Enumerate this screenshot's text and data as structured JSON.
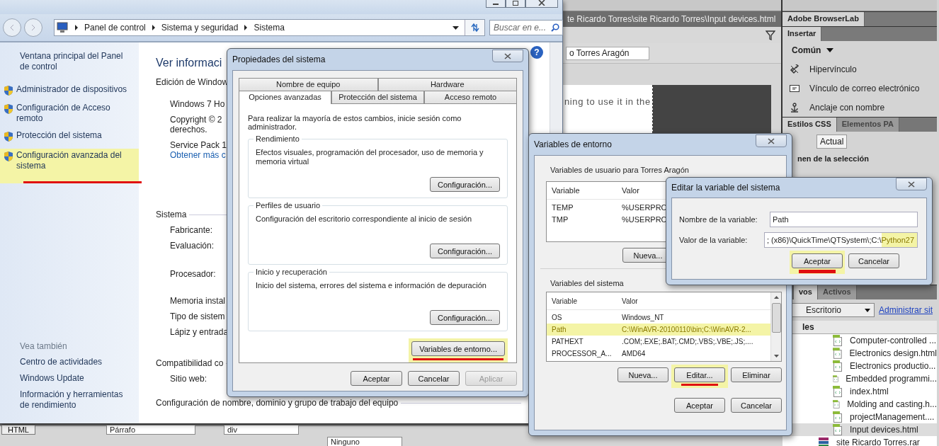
{
  "dreamweaver": {
    "doc_tab": "te Ricardo Torres\\site Ricardo Torres\\Input devices.html",
    "title_field": "o Torres Aragón",
    "doc_text": "ning to use it in the",
    "browserlab_tab": "Adobe BrowserLab",
    "insert_tab": "Insertar",
    "category": "Común",
    "insert_items": [
      {
        "label": "Hipervínculo",
        "kind": "link"
      },
      {
        "label": "Vínculo de correo electrónico",
        "kind": "email"
      },
      {
        "label": "Anclaje con nombre",
        "kind": "anchor"
      }
    ],
    "css_tabs": [
      {
        "label": "Estilos CSS",
        "selected": true
      },
      {
        "label": "Elementos PA",
        "selected": false
      }
    ],
    "css_mode": "Actual",
    "css_heading": "nen de la selección",
    "files_tabs": [
      {
        "label": "vos",
        "selected": true
      },
      {
        "label": "Activos",
        "selected": false
      }
    ],
    "site_select": "Escritorio",
    "manage_link": "Administrar sit",
    "files_header": "les",
    "files": [
      {
        "name": "Computer-controlled ...",
        "kind": "html",
        "selected": false
      },
      {
        "name": "Electronics design.html",
        "kind": "html",
        "selected": false
      },
      {
        "name": "Electronics productio...",
        "kind": "html",
        "selected": false
      },
      {
        "name": "Embedded programmi...",
        "kind": "html",
        "selected": false
      },
      {
        "name": "index.html",
        "kind": "html",
        "selected": false
      },
      {
        "name": "Molding and casting.h...",
        "kind": "html",
        "selected": false
      },
      {
        "name": "projectManagement....",
        "kind": "html",
        "selected": false
      },
      {
        "name": "Input devices.html",
        "kind": "html",
        "selected": true
      },
      {
        "name": "site Ricardo Torres.rar",
        "kind": "archive",
        "selected": false
      }
    ],
    "properties_bar": {
      "view_button": "HTML",
      "format": "Párrafo",
      "class": "div",
      "id": "Ninguno"
    }
  },
  "control_panel": {
    "address": [
      "Panel de control",
      "Sistema y seguridad",
      "Sistema"
    ],
    "search": {
      "placeholder": "Buscar en e..."
    },
    "help": "?",
    "sidebar": {
      "home": "Ventana principal del Panel de control",
      "tasks": [
        {
          "label": "Administrador de dispositivos",
          "highlighted": false,
          "underlined": false
        },
        {
          "label": "Configuración de Acceso remoto",
          "highlighted": false,
          "underlined": false
        },
        {
          "label": "Protección del sistema",
          "highlighted": false,
          "underlined": false
        },
        {
          "label": "Configuración avanzada del sistema",
          "highlighted": true,
          "underlined": true
        }
      ],
      "see_also_title": "Vea también",
      "see_also": [
        "Centro de actividades",
        "Windows Update",
        "Información y herramientas de rendimiento"
      ]
    },
    "content": [
      {
        "kind": "title",
        "text": "Ver informaci"
      },
      {
        "kind": "heading",
        "text": "Edición de Window"
      },
      {
        "kind": "item",
        "text": "Windows 7 Ho"
      },
      {
        "kind": "item",
        "text": "Copyright © 2"
      },
      {
        "kind": "wrap",
        "text": "derechos."
      },
      {
        "kind": "item",
        "text": "Service Pack 1"
      },
      {
        "kind": "link",
        "text": "Obtener más c"
      },
      {
        "kind": "section",
        "text": "Sistema"
      },
      {
        "kind": "item",
        "text": "Fabricante:"
      },
      {
        "kind": "item",
        "text": "Evaluación:"
      },
      {
        "kind": "tall",
        "text": "Procesador:"
      },
      {
        "kind": "item",
        "text": "Memoria instal"
      },
      {
        "kind": "item",
        "text": "Tipo de sistem"
      },
      {
        "kind": "item",
        "text": "Lápiz y entrada"
      },
      {
        "kind": "section",
        "text": "Compatibilidad co"
      },
      {
        "kind": "item",
        "text": "Sitio web:"
      },
      {
        "kind": "section",
        "text": "Configuración de nombre, dominio y grupo de trabajo del equipo"
      }
    ]
  },
  "system_properties": {
    "title": "Propiedades del sistema",
    "tab_rows": [
      [
        {
          "label": "Nombre de equipo",
          "selected": false
        },
        {
          "label": "Hardware",
          "selected": false
        }
      ],
      [
        {
          "label": "Opciones avanzadas",
          "selected": true
        },
        {
          "label": "Protección del sistema",
          "selected": false
        },
        {
          "label": "Acceso remoto",
          "selected": false
        }
      ]
    ],
    "intro": "Para realizar la mayoría de estos cambios, inicie sesión como administrador.",
    "groups": [
      {
        "title": "Rendimiento",
        "description": "Efectos visuales, programación del procesador, uso de memoria y memoria virtual",
        "button": "Configuración..."
      },
      {
        "title": "Perfiles de usuario",
        "description": "Configuración del escritorio correspondiente al inicio de sesión",
        "button": "Configuración..."
      },
      {
        "title": "Inicio y recuperación",
        "description": "Inicio del sistema, errores del sistema e información de depuración",
        "button": "Configuración..."
      }
    ],
    "env_button": {
      "label": "Variables de entorno...",
      "highlighted": true,
      "underlined": true
    },
    "buttons": [
      {
        "label": "Aceptar",
        "disabled": false
      },
      {
        "label": "Cancelar",
        "disabled": false
      },
      {
        "label": "Aplicar",
        "disabled": true
      }
    ]
  },
  "environment_variables": {
    "title": "Variables de entorno",
    "user": {
      "title": "Variables de usuario para Torres Aragón",
      "columns": [
        "Variable",
        "Valor"
      ],
      "rows": [
        {
          "variable": "TEMP",
          "value": "%USERPRO"
        },
        {
          "variable": "TMP",
          "value": "%USERPRO"
        }
      ],
      "buttons": [
        "Nueva..."
      ]
    },
    "system": {
      "title": "Variables del sistema",
      "columns": [
        "Variable",
        "Valor"
      ],
      "rows": [
        {
          "variable": "OS",
          "value": "Windows_NT",
          "highlighted": false
        },
        {
          "variable": "Path",
          "value": "C:\\WinAVR-20100110\\bin;C:\\WinAVR-2...",
          "highlighted": true
        },
        {
          "variable": "PATHEXT",
          "value": ".COM;.EXE;.BAT;.CMD;.VBS;.VBE;.JS;....",
          "highlighted": false
        },
        {
          "variable": "PROCESSOR_A...",
          "value": "AMD64",
          "highlighted": false
        }
      ],
      "buttons": [
        {
          "label": "Nueva...",
          "highlighted": false,
          "underlined": false
        },
        {
          "label": "Editar...",
          "highlighted": true,
          "underlined": true
        },
        {
          "label": "Eliminar",
          "highlighted": false,
          "underlined": false
        }
      ]
    },
    "buttons": [
      "Aceptar",
      "Cancelar"
    ]
  },
  "edit_variable": {
    "title": "Editar la variable del sistema",
    "fields": [
      {
        "label": "Nombre de la variable:",
        "parts": [
          {
            "text": "Path",
            "highlighted": false
          }
        ]
      },
      {
        "label": "Valor de la variable:",
        "parts": [
          {
            "text": "; (x86)\\QuickTime\\QTSystem\\;C:\\",
            "highlighted": false
          },
          {
            "text": "Python27",
            "highlighted": true
          }
        ]
      }
    ],
    "buttons": [
      {
        "label": "Aceptar",
        "highlighted": true,
        "underlined": true
      },
      {
        "label": "Cancelar",
        "highlighted": false,
        "underlined": false
      }
    ]
  }
}
